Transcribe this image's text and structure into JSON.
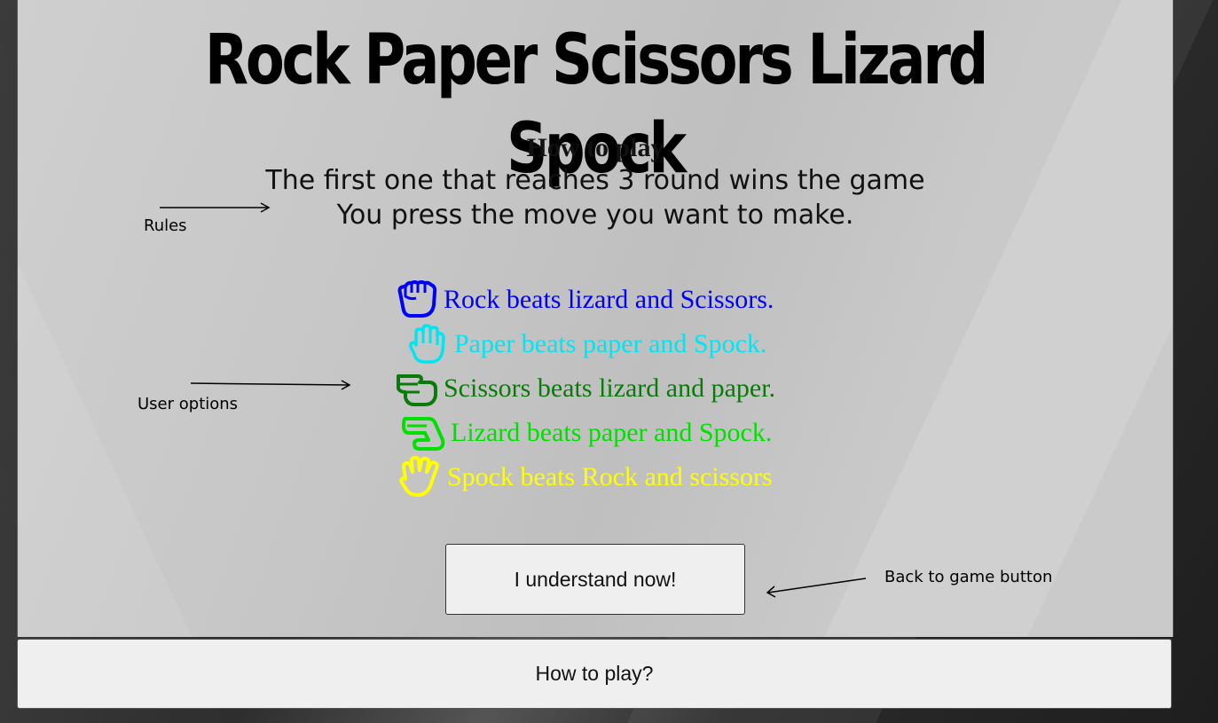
{
  "title": "Rock Paper Scissors Lizard Spock",
  "instructions": {
    "heading": "How to play",
    "lines": [
      "The first one that reaches 3 round wins the game",
      "You press the move you want to make."
    ]
  },
  "annotations": {
    "rules": "Rules",
    "user_options": "User options",
    "back_button": "Back to game button"
  },
  "moves": [
    {
      "name": "rock",
      "text": "Rock beats lizard and Scissors.",
      "color": "#0000ff",
      "icon": "hand-rock-icon"
    },
    {
      "name": "paper",
      "text": "Paper beats paper and Spock.",
      "color": "#00e5f0",
      "icon": "hand-paper-icon"
    },
    {
      "name": "scissors",
      "text": "Scissors beats lizard and paper.",
      "color": "#0a7a0a",
      "icon": "hand-scissors-icon"
    },
    {
      "name": "lizard",
      "text": "Lizard beats paper and Spock.",
      "color": "#00e000",
      "icon": "hand-lizard-icon"
    },
    {
      "name": "spock",
      "text": "Spock beats Rock and scissors",
      "color": "#ffff00",
      "icon": "hand-spock-icon"
    }
  ],
  "buttons": {
    "understand": "I understand now!",
    "how_to_play": "How to play?"
  }
}
